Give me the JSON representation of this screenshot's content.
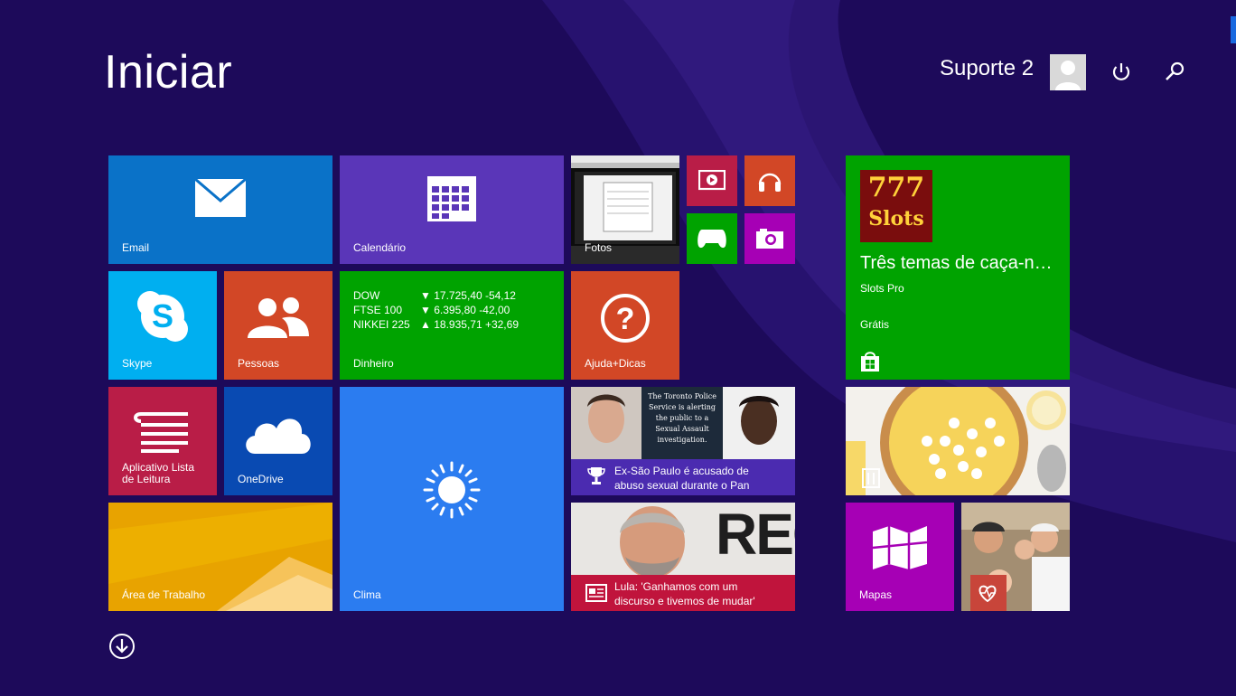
{
  "header": {
    "title": "Iniciar",
    "user_name": "Suporte 2"
  },
  "tiles": {
    "email": "Email",
    "calendar": "Calendário",
    "photos": "Fotos",
    "skype": "Skype",
    "people": "Pessoas",
    "money": "Dinheiro",
    "help": "Ajuda+Dicas",
    "reading_list": "Aplicativo Lista de Leitura",
    "onedrive": "OneDrive",
    "weather": "Clima",
    "desktop": "Área de Trabalho",
    "maps": "Mapas"
  },
  "money": {
    "rows": [
      {
        "name": "DOW",
        "arrow": "▼",
        "value": "17.725,40 -54,12"
      },
      {
        "name": "FTSE 100",
        "arrow": "▼",
        "value": "6.395,80 -42,00"
      },
      {
        "name": "NIKKEI 225",
        "arrow": "▲",
        "value": "18.935,71 +32,69"
      }
    ]
  },
  "store": {
    "app_logo_line1": "777",
    "app_logo_line2": "Slots",
    "headline": "Três temas de caça-n…",
    "app_name": "Slots Pro",
    "price": "Grátis"
  },
  "news": {
    "sport_headline": "Ex-São Paulo é acusado de abuso sexual durante o Pan",
    "sport_photo_text": "The Toronto Police Service is alerting the public to a Sexual Assault investigation.",
    "politics_headline": "Lula: 'Ganhamos com um discurso e tivemos de mudar'",
    "politics_photo_text": "REC"
  },
  "colors": {
    "background": "#1d0a5a",
    "email": "#0a72c8",
    "calendar": "#5a36b8",
    "skype": "#00aff0",
    "people": "#d24726",
    "money": "#00a300",
    "help": "#d24726",
    "reading_list": "#b91d47",
    "onedrive": "#094ab2",
    "weather": "#2b7cf0",
    "store": "#00a300",
    "maps": "#a600b5",
    "news_sport": "#4b2bb0",
    "news_politics": "#c0143c"
  },
  "icons": [
    "power-icon",
    "search-icon",
    "scroll-down-icon"
  ]
}
